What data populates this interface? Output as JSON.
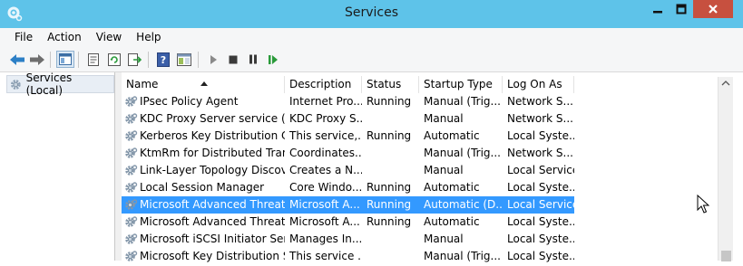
{
  "window": {
    "title": "Services"
  },
  "menu": [
    "File",
    "Action",
    "View",
    "Help"
  ],
  "tree": {
    "root_label": "Services (Local)"
  },
  "columns": [
    "Name",
    "Description",
    "Status",
    "Startup Type",
    "Log On As"
  ],
  "sort": {
    "column": "Name",
    "direction": "ascending"
  },
  "rows": [
    {
      "name": "IPsec Policy Agent",
      "description": "Internet Pro...",
      "status": "Running",
      "startup": "Manual (Trig...",
      "logon": "Network S..."
    },
    {
      "name": "KDC Proxy Server service (K...",
      "description": "KDC Proxy S...",
      "status": "",
      "startup": "Manual",
      "logon": "Network S..."
    },
    {
      "name": "Kerberos Key Distribution C...",
      "description": "This service,...",
      "status": "Running",
      "startup": "Automatic",
      "logon": "Local Syste..."
    },
    {
      "name": "KtmRm for Distributed Tran...",
      "description": "Coordinates...",
      "status": "",
      "startup": "Manual (Trig...",
      "logon": "Network S..."
    },
    {
      "name": "Link-Layer Topology Discov...",
      "description": "Creates a N...",
      "status": "",
      "startup": "Manual",
      "logon": "Local Service"
    },
    {
      "name": "Local Session Manager",
      "description": "Core Windo...",
      "status": "Running",
      "startup": "Automatic",
      "logon": "Local Syste..."
    },
    {
      "name": "Microsoft Advanced Threat ...",
      "description": "Microsoft A...",
      "status": "Running",
      "startup": "Automatic (D...",
      "logon": "Local Service",
      "selected": true
    },
    {
      "name": "Microsoft Advanced Threat ...",
      "description": "Microsoft A...",
      "status": "Running",
      "startup": "Automatic",
      "logon": "Local Syste..."
    },
    {
      "name": "Microsoft iSCSI Initiator Ser...",
      "description": "Manages In...",
      "status": "",
      "startup": "Manual",
      "logon": "Local Syste..."
    },
    {
      "name": "Microsoft Key Distribution S...",
      "description": "This service ...",
      "status": "",
      "startup": "Manual (Trig...",
      "logon": "Local Syste..."
    }
  ],
  "colors": {
    "titlebar": "#5ec3e9",
    "close": "#c7503f",
    "selection": "#3399ff",
    "toolbar": "#f5f6f7"
  },
  "icons": [
    "app-icon",
    "minimize-icon",
    "maximize-icon",
    "close-icon",
    "back-arrow-icon",
    "forward-arrow-icon",
    "console-tree-icon",
    "properties-icon",
    "refresh-icon",
    "export-list-icon",
    "help-icon",
    "view-pane-icon",
    "start-service-icon",
    "stop-service-icon",
    "pause-service-icon",
    "resume-service-icon",
    "gear-icon"
  ]
}
